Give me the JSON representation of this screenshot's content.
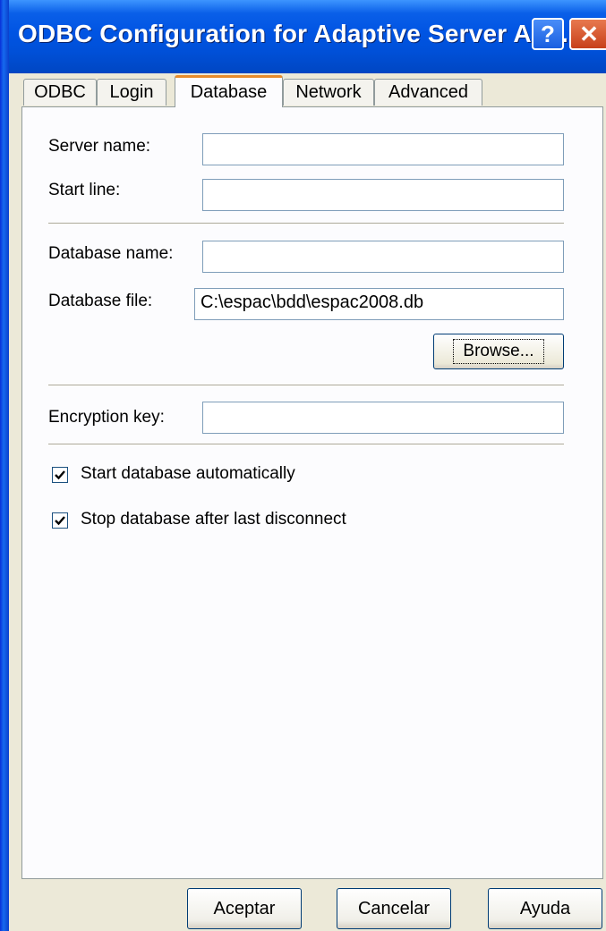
{
  "window": {
    "title": "ODBC Configuration for Adaptive Server An...",
    "help_glyph": "?",
    "close_glyph": "✕"
  },
  "tabs": [
    {
      "label": "ODBC",
      "active": false
    },
    {
      "label": "Login",
      "active": false
    },
    {
      "label": "Database",
      "active": true
    },
    {
      "label": "Network",
      "active": false
    },
    {
      "label": "Advanced",
      "active": false
    }
  ],
  "form": {
    "server_name_label": "Server name:",
    "server_name_value": "",
    "start_line_label": "Start line:",
    "start_line_value": "",
    "database_name_label": "Database name:",
    "database_name_value": "",
    "database_file_label": "Database file:",
    "database_file_value": "C:\\espac\\bdd\\espac2008.db",
    "browse_label": "Browse...",
    "encryption_key_label": "Encryption key:",
    "encryption_key_value": "",
    "start_auto_label": "Start database automatically",
    "start_auto_checked": true,
    "stop_after_label": "Stop database after last disconnect",
    "stop_after_checked": true
  },
  "buttons": {
    "ok": "Aceptar",
    "cancel": "Cancelar",
    "help": "Ayuda"
  },
  "colors": {
    "title_bar": "#0054e3",
    "active_tab_accent": "#e68b2c",
    "dialog_bg": "#ece9d8"
  }
}
